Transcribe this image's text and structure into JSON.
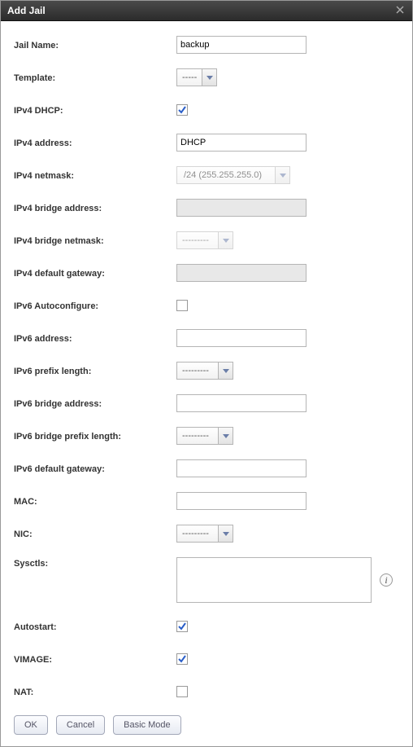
{
  "window": {
    "title": "Add Jail"
  },
  "fields": {
    "jail_name": {
      "label": "Jail Name:",
      "value": "backup"
    },
    "template": {
      "label": "Template:",
      "value": "-----"
    },
    "ipv4_dhcp": {
      "label": "IPv4 DHCP:",
      "checked": true
    },
    "ipv4_address": {
      "label": "IPv4 address:",
      "value": "DHCP"
    },
    "ipv4_netmask": {
      "label": "IPv4 netmask:",
      "value": "/24 (255.255.255.0)"
    },
    "ipv4_bridge_address": {
      "label": "IPv4 bridge address:",
      "value": ""
    },
    "ipv4_bridge_netmask": {
      "label": "IPv4 bridge netmask:",
      "value": "---------"
    },
    "ipv4_default_gateway": {
      "label": "IPv4 default gateway:",
      "value": ""
    },
    "ipv6_autoconfigure": {
      "label": "IPv6 Autoconfigure:",
      "checked": false
    },
    "ipv6_address": {
      "label": "IPv6 address:",
      "value": ""
    },
    "ipv6_prefix_length": {
      "label": "IPv6 prefix length:",
      "value": "---------"
    },
    "ipv6_bridge_address": {
      "label": "IPv6 bridge address:",
      "value": ""
    },
    "ipv6_bridge_prefix_length": {
      "label": "IPv6 bridge prefix length:",
      "value": "---------"
    },
    "ipv6_default_gateway": {
      "label": "IPv6 default gateway:",
      "value": ""
    },
    "mac": {
      "label": "MAC:",
      "value": ""
    },
    "nic": {
      "label": "NIC:",
      "value": "---------"
    },
    "sysctls": {
      "label": "Sysctls:",
      "value": ""
    },
    "autostart": {
      "label": "Autostart:",
      "checked": true
    },
    "vimage": {
      "label": "VIMAGE:",
      "checked": true
    },
    "nat": {
      "label": "NAT:",
      "checked": false
    }
  },
  "buttons": {
    "ok": "OK",
    "cancel": "Cancel",
    "basic_mode": "Basic Mode"
  }
}
